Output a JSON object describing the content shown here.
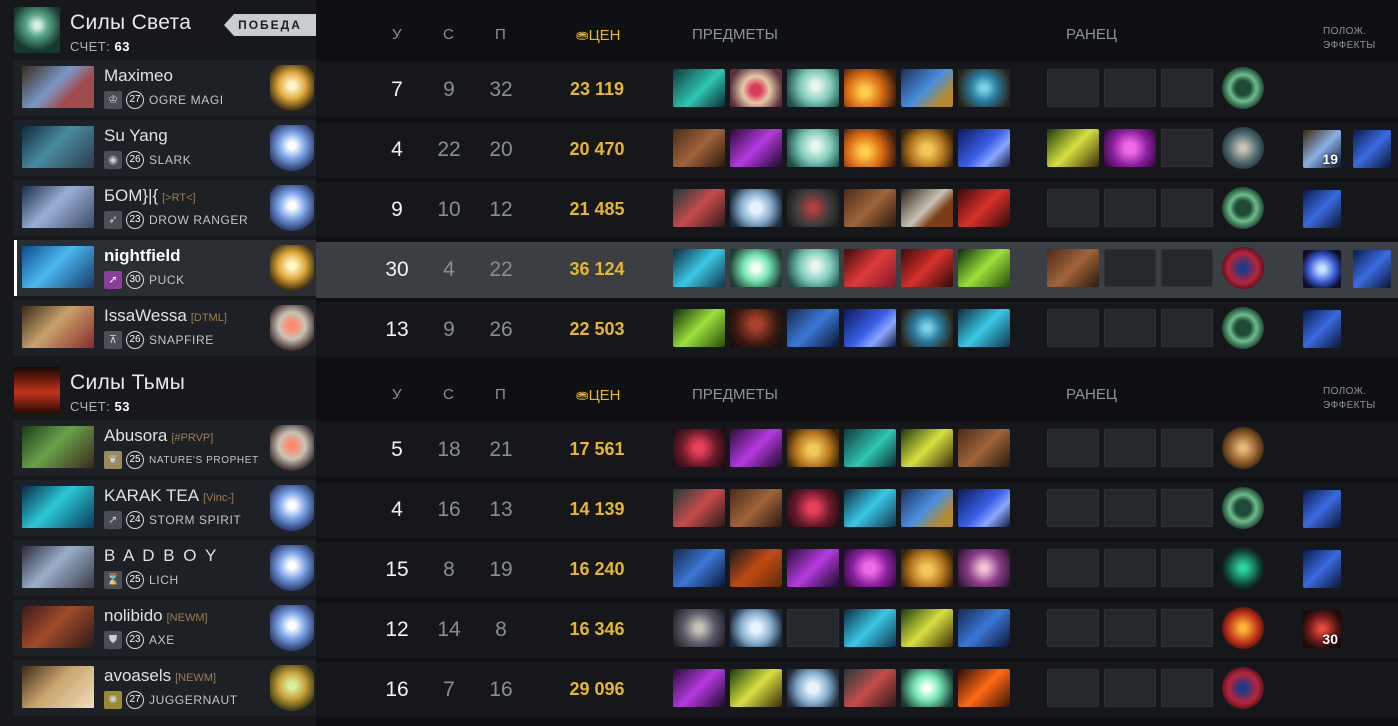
{
  "headers": {
    "k": "У",
    "d": "С",
    "a": "П",
    "networth": "ЦЕН",
    "items": "ПРЕДМЕТЫ",
    "backpack": "РАНЕЦ",
    "effects_line1": "ПОЛОЖ.",
    "effects_line2": "ЭФФЕКТЫ"
  },
  "radiant": {
    "name": "Силы Света",
    "score_label": "СЧЕТ:",
    "score": "63",
    "result": "ПОБЕДА",
    "players": [
      {
        "name": "Maximeo",
        "tag": "",
        "level": "27",
        "hero": "OGRE MAGI",
        "k": "7",
        "d": "9",
        "a": "32",
        "networth": "23 119"
      },
      {
        "name": "Su Yang",
        "tag": "",
        "level": "26",
        "hero": "SLARK",
        "k": "4",
        "d": "22",
        "a": "20",
        "networth": "20 470",
        "buff_count": "19"
      },
      {
        "name": "БОМ}|{",
        "tag": "[>RT<]",
        "level": "23",
        "hero": "DROW RANGER",
        "k": "9",
        "d": "10",
        "a": "12",
        "networth": "21 485"
      },
      {
        "name": "nightfield",
        "tag": "",
        "level": "30",
        "hero": "PUCK",
        "k": "30",
        "d": "4",
        "a": "22",
        "networth": "36 124"
      },
      {
        "name": "IssaWessa",
        "tag": "[DTML]",
        "level": "26",
        "hero": "SNAPFIRE",
        "k": "13",
        "d": "9",
        "a": "26",
        "networth": "22 503"
      }
    ]
  },
  "dire": {
    "name": "Силы Тьмы",
    "score_label": "СЧЕТ:",
    "score": "53",
    "players": [
      {
        "name": "Abusora",
        "tag": "[#PRVP]",
        "level": "25",
        "hero": "NATURE'S PROPHET",
        "k": "5",
        "d": "18",
        "a": "21",
        "networth": "17 561"
      },
      {
        "name": "KARAK TEA",
        "tag": "[Vinc-]",
        "level": "24",
        "hero": "STORM SPIRIT",
        "k": "4",
        "d": "16",
        "a": "13",
        "networth": "14 139"
      },
      {
        "name": "B A D B O Y",
        "tag": "",
        "level": "25",
        "hero": "LICH",
        "k": "15",
        "d": "8",
        "a": "19",
        "networth": "16 240"
      },
      {
        "name": "nolibido",
        "tag": "[NEWM]",
        "level": "23",
        "hero": "AXE",
        "k": "12",
        "d": "14",
        "a": "8",
        "networth": "16 346",
        "buff_count": "30"
      },
      {
        "name": "avoasels",
        "tag": "[NEWM]",
        "level": "27",
        "hero": "JUGGERNAUT",
        "k": "16",
        "d": "7",
        "a": "16",
        "networth": "29 096"
      }
    ]
  },
  "colors": {
    "accent_gold": "#e7b630",
    "highlight_row": "#3b3f44",
    "victory_badge": "#c9cdd1"
  }
}
